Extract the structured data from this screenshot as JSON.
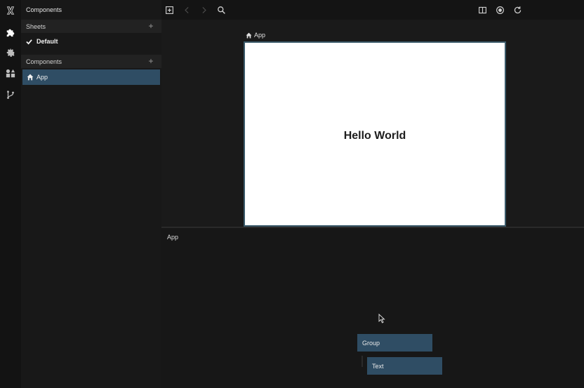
{
  "sidebar": {
    "title": "Components",
    "sheets_header": "Sheets",
    "sheets": [
      {
        "label": "Default",
        "selected": true
      }
    ],
    "components_header": "Components",
    "components": [
      {
        "label": "App",
        "selected": true
      }
    ]
  },
  "rail": {
    "icons": [
      "logo-icon",
      "puzzle-icon",
      "gear-icon",
      "component-shapes-icon",
      "branch-icon"
    ]
  },
  "toolbar": {
    "icons": [
      "add-frame-icon",
      "back-icon",
      "forward-icon",
      "search-icon",
      "split-view-icon",
      "record-icon",
      "refresh-icon"
    ]
  },
  "canvas": {
    "frame_label": "App",
    "hello_text": "Hello World",
    "background": "#ffffff"
  },
  "graph": {
    "title": "App",
    "nodes": [
      {
        "label": "Group"
      },
      {
        "label": "Text"
      }
    ]
  },
  "colors": {
    "accent": "#2f4d64",
    "frame_border": "#3b5a6a"
  }
}
